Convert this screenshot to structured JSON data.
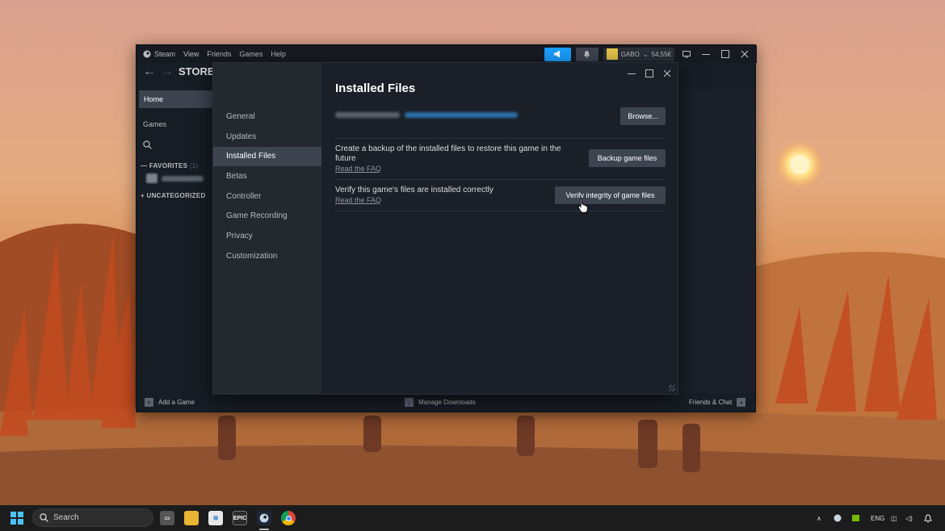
{
  "window": {
    "menu": [
      "Steam",
      "View",
      "Friends",
      "Games",
      "Help"
    ],
    "profile": {
      "name": "GABO",
      "balance": "54,55€"
    },
    "nav_title": "STORE"
  },
  "library": {
    "home": "Home",
    "games": "Games",
    "favorites": "FAVORITES",
    "favorites_count": "(1)",
    "uncategorized": "UNCATEGORIZED"
  },
  "footer": {
    "add_game": "Add a Game",
    "manage_downloads": "Manage Downloads",
    "friends_chat": "Friends & Chat"
  },
  "properties": {
    "nav": [
      "General",
      "Updates",
      "Installed Files",
      "Betas",
      "Controller",
      "Game Recording",
      "Privacy",
      "Customization"
    ],
    "selected": "Installed Files",
    "title": "Installed Files",
    "browse": "Browse...",
    "backup_text": "Create a backup of the installed files to restore this game in the future",
    "backup_btn": "Backup game files",
    "faq": "Read the FAQ",
    "verify_text": "Verify this game's files are installed correctly",
    "verify_btn": "Verify integrity of game files"
  },
  "taskbar": {
    "search": "Search",
    "epic": "EPIC",
    "lang": "ENG"
  },
  "colors": {
    "accent": "#1a9fff",
    "panel": "#1b2229",
    "selected": "#3d4450"
  }
}
